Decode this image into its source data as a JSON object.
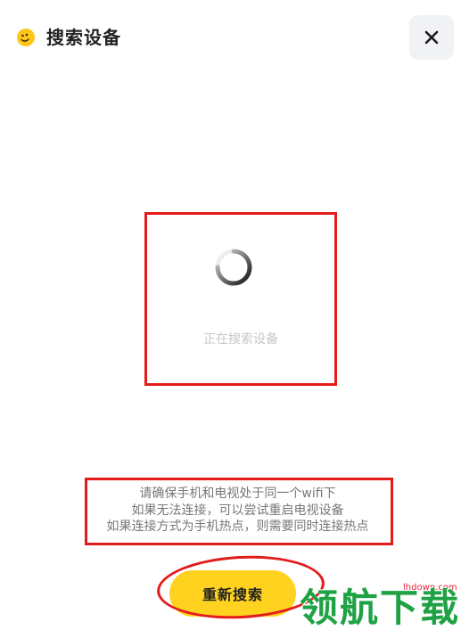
{
  "header": {
    "title": "搜索设备",
    "logo_icon": "emoji-face-icon",
    "close_icon": "close-icon"
  },
  "search": {
    "status": "正在搜索设备"
  },
  "tips": {
    "lines": [
      "请确保手机和电视处于同一个wifi下",
      "如果无法连接，可以尝试重启电视设备",
      "如果连接方式为手机热点，则需要同时连接热点"
    ]
  },
  "actions": {
    "retry_label": "重新搜索"
  },
  "watermark": {
    "text": "领航下载",
    "url": "lhdown.com"
  },
  "colors": {
    "accent": "#ffd21f",
    "annotation": "#e21b1b",
    "watermark": "#1fa244"
  }
}
